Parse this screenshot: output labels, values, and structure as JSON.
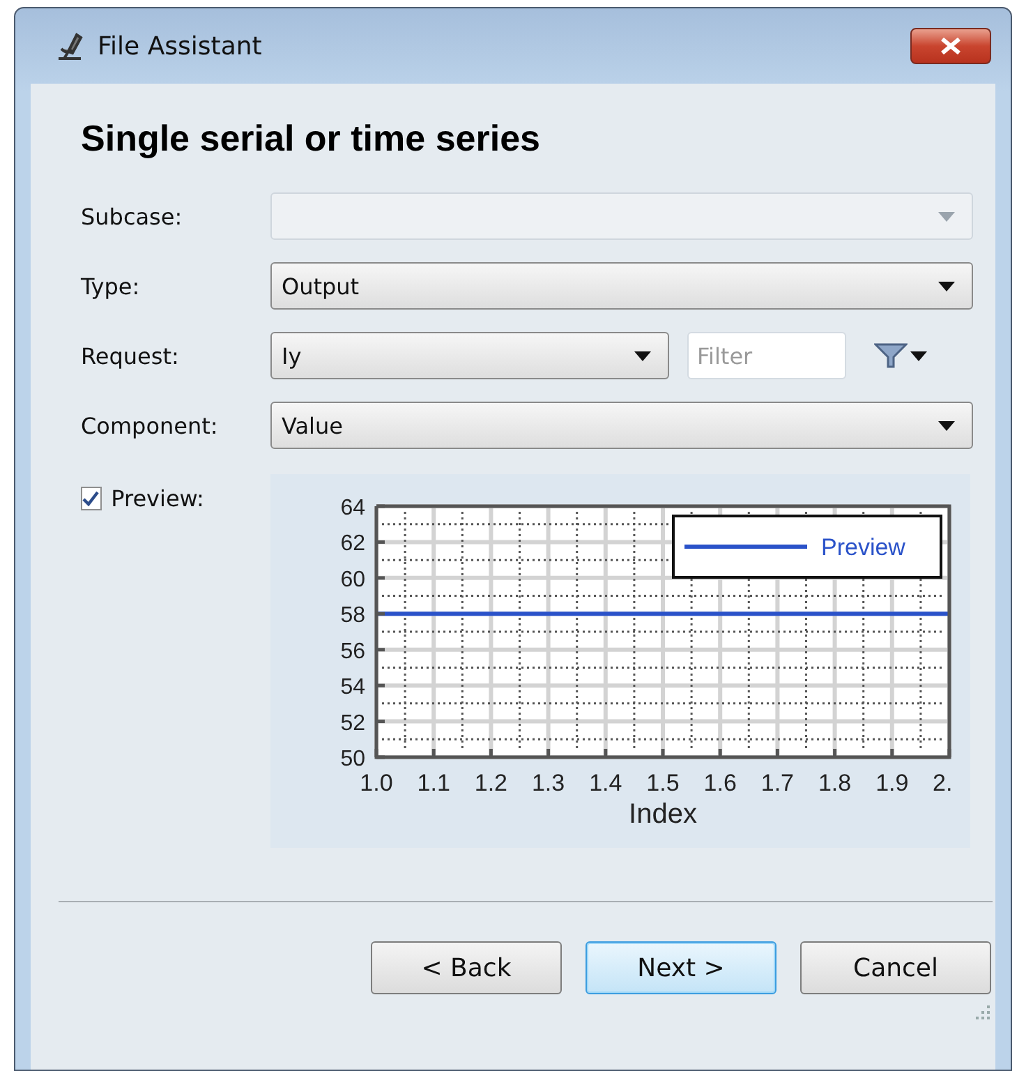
{
  "window": {
    "title": "File Assistant"
  },
  "heading": "Single serial or time series",
  "fields": [
    {
      "kind": "dropdown",
      "label": "Subcase:",
      "disabled": true
    },
    {
      "kind": "dropdown",
      "label": "Type:",
      "value": "Output",
      "disabled": false
    },
    {
      "kind": "dropdown-filter",
      "label": "Request:",
      "value": "Iy",
      "disabled": false,
      "filter": {
        "placeholder": "Filter"
      }
    },
    {
      "kind": "dropdown",
      "label": "Component:",
      "value": "Value",
      "disabled": false
    }
  ],
  "preview": {
    "label": "Preview:",
    "checked": true,
    "chart_data": {
      "type": "line",
      "xlabel": "Index",
      "x": [
        1.0,
        2.0
      ],
      "series": [
        {
          "name": "Preview",
          "color": "#2a52c9",
          "values": [
            58,
            58
          ]
        }
      ],
      "xlim": [
        1.0,
        2.0
      ],
      "ylim": [
        50,
        64
      ],
      "xticks": [
        {
          "value": 1.0,
          "label": "1.0"
        },
        {
          "value": 1.1,
          "label": "1.1"
        },
        {
          "value": 1.2,
          "label": "1.2"
        },
        {
          "value": 1.3,
          "label": "1.3"
        },
        {
          "value": 1.4,
          "label": "1.4"
        },
        {
          "value": 1.5,
          "label": "1.5"
        },
        {
          "value": 1.6,
          "label": "1.6"
        },
        {
          "value": 1.7,
          "label": "1.7"
        },
        {
          "value": 1.8,
          "label": "1.8"
        },
        {
          "value": 1.9,
          "label": "1.9"
        },
        {
          "value": 2.0,
          "label": "2."
        }
      ],
      "yticks": [
        50,
        52,
        54,
        56,
        58,
        60,
        62,
        64
      ],
      "grid": true
    }
  },
  "buttons": [
    {
      "label": "< Back",
      "selected": false
    },
    {
      "label": "Next >",
      "selected": true
    },
    {
      "label": "Cancel",
      "selected": false
    }
  ]
}
